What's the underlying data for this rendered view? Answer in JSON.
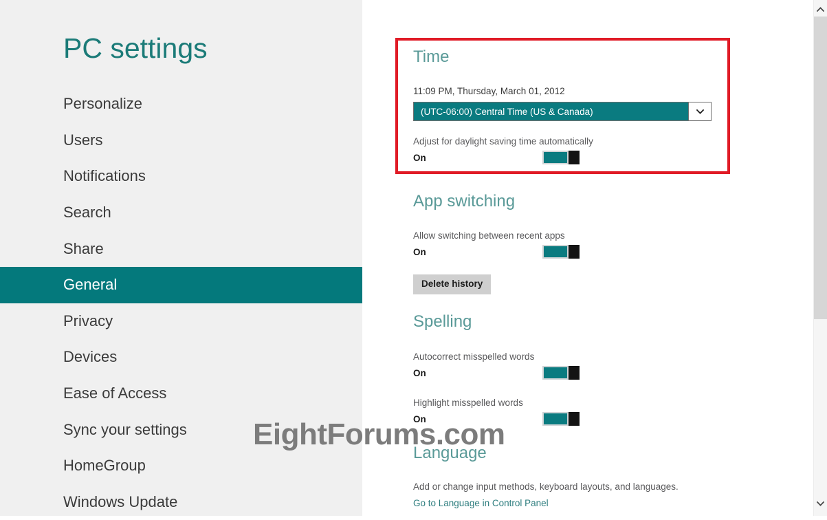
{
  "sidebar": {
    "title": "PC settings",
    "items": [
      {
        "label": "Personalize",
        "selected": false
      },
      {
        "label": "Users",
        "selected": false
      },
      {
        "label": "Notifications",
        "selected": false
      },
      {
        "label": "Search",
        "selected": false
      },
      {
        "label": "Share",
        "selected": false
      },
      {
        "label": "General",
        "selected": true
      },
      {
        "label": "Privacy",
        "selected": false
      },
      {
        "label": "Devices",
        "selected": false
      },
      {
        "label": "Ease of Access",
        "selected": false
      },
      {
        "label": "Sync your settings",
        "selected": false
      },
      {
        "label": "HomeGroup",
        "selected": false
      },
      {
        "label": "Windows Update",
        "selected": false
      }
    ]
  },
  "content": {
    "time": {
      "heading": "Time",
      "current_datetime": "11:09 PM, Thursday, March 01, 2012",
      "timezone_selected": "(UTC-06:00) Central Time (US & Canada)",
      "dst_label": "Adjust for daylight saving time automatically",
      "dst_state": "On"
    },
    "app_switching": {
      "heading": "App switching",
      "allow_label": "Allow switching between recent apps",
      "allow_state": "On",
      "delete_history_button": "Delete history"
    },
    "spelling": {
      "heading": "Spelling",
      "autocorrect_label": "Autocorrect misspelled words",
      "autocorrect_state": "On",
      "highlight_label": "Highlight misspelled words",
      "highlight_state": "On"
    },
    "language": {
      "heading": "Language",
      "description": "Add or change input methods, keyboard layouts, and languages.",
      "control_panel_link": "Go to Language in Control Panel"
    }
  },
  "watermark": {
    "text": "EightForums.com"
  },
  "annotation": {
    "highlight_color": "#e01b26",
    "target_section": "Time"
  },
  "colors": {
    "accent_teal": "#04797c",
    "heading_teal": "#5a9a98",
    "title_teal": "#1b7b78",
    "sidebar_bg": "#f0f0f0",
    "toggle_on": "#0a7b80",
    "toggle_knob": "#141414",
    "link_teal": "#2d7d7e",
    "button_bg": "#cfcfcf"
  },
  "scrollbar": {
    "up_icon": "chevron-up-icon",
    "down_icon": "chevron-down-icon"
  }
}
